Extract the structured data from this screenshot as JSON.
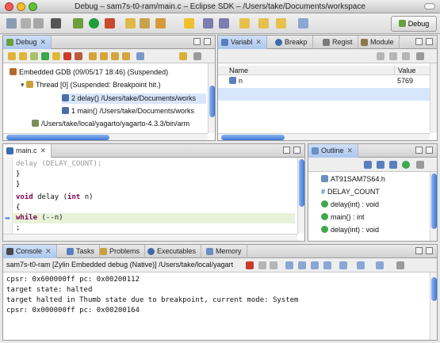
{
  "window": {
    "title": "Debug – sam7s-t0-ram/main.c – Eclipse SDK – /Users/take/Documents/workspace"
  },
  "toolbar": {
    "perspective_label": "Debug"
  },
  "debug_view": {
    "tab": "Debug",
    "tree": [
      {
        "label": "Embedded GDB (09/05/17 18:46) (Suspended)",
        "icon": "gdb-icon"
      },
      {
        "label": "Thread [0] (Suspended: Breakpoint hit.)",
        "icon": "thread-icon"
      },
      {
        "label": "2 delay() /Users/take/Documents/works",
        "icon": "stack-frame-icon",
        "selected": true
      },
      {
        "label": "1 main() /Users/take/Documents/works",
        "icon": "stack-frame-icon"
      },
      {
        "label": "/Users/take/local/yagarto/yagarto-4.3.3/bin/arm",
        "icon": "process-icon"
      }
    ]
  },
  "variables_view": {
    "tabs": [
      "Variabl",
      "Breakp",
      "Regist",
      "Module"
    ],
    "columns": [
      "Name",
      "Value"
    ],
    "rows": [
      {
        "name": "n",
        "value": "5769"
      }
    ]
  },
  "editor": {
    "tab": "main.c",
    "lines": [
      "    delay (DELAY_COUNT);",
      "  }",
      "}",
      "",
      "void delay (int n)",
      "{",
      "  while (--n)",
      "    ;",
      "}"
    ]
  },
  "outline_view": {
    "tab": "Outline",
    "items": [
      {
        "label": "AT91SAM7S64.h",
        "icon": "include-icon"
      },
      {
        "label": "DELAY_COUNT",
        "icon": "macro-icon"
      },
      {
        "label": "delay(int) : void",
        "icon": "function-icon"
      },
      {
        "label": "main() : int",
        "icon": "function-icon"
      },
      {
        "label": "delay(int) : void",
        "icon": "function-icon"
      }
    ]
  },
  "console_view": {
    "tabs": [
      "Console",
      "Tasks",
      "Problems",
      "Executables",
      "Memory"
    ],
    "header": "sam7s-t0-ram [Zylin Embedded debug (Native)] /Users/take/local/yagart",
    "lines": [
      "cpsr: 0x600000ff pc: 0x00200112",
      "target state: halted",
      "target halted in Thumb state due to breakpoint, current mode: System",
      "cpsr: 0x000000ff pc: 0x00200164"
    ]
  },
  "colors": {
    "accent": "#3c77d6",
    "selection": "#d7e6fb",
    "keyword": "#7f0055",
    "current_line": "#e8f2d8"
  }
}
